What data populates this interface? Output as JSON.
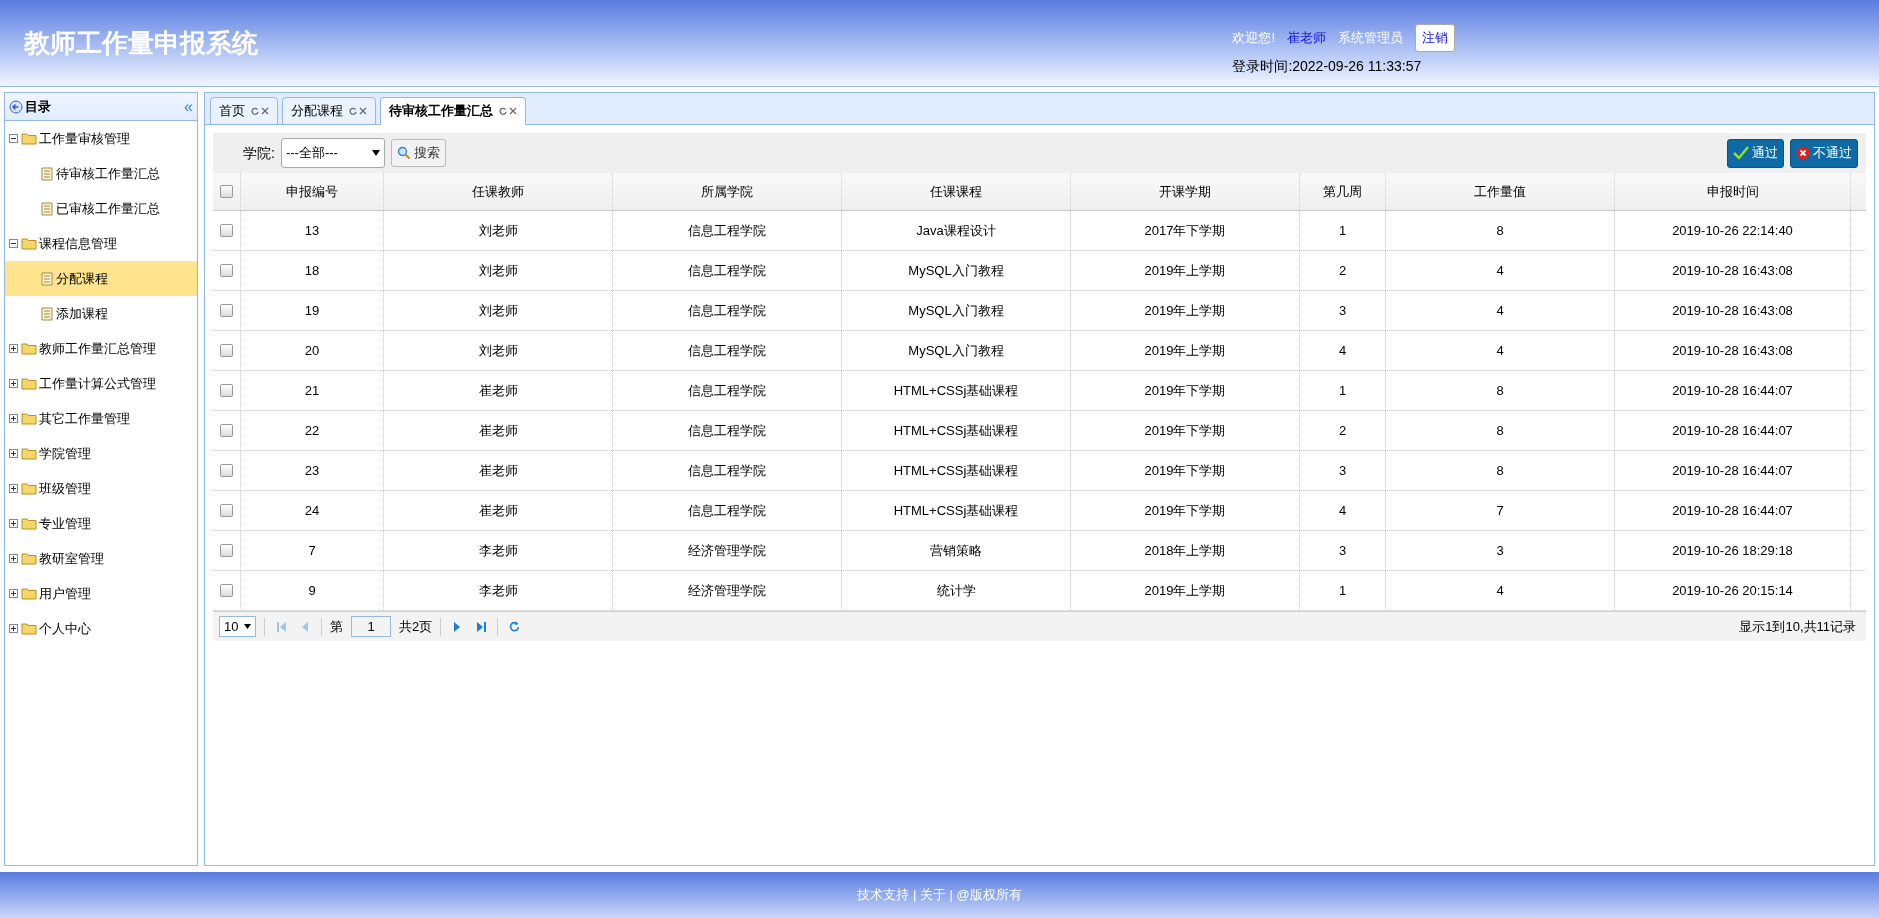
{
  "header": {
    "title": "教师工作量申报系统",
    "welcome": "欢迎您!",
    "user": "崔老师",
    "role": "系统管理员",
    "logout": "注销",
    "login_time": "登录时间:2022-09-26 11:33:57"
  },
  "sidebar": {
    "title": "目录",
    "collapse": "«",
    "items": [
      {
        "label": "工作量审核管理",
        "expanded": true,
        "selected": false,
        "children": [
          {
            "label": "待审核工作量汇总",
            "selected": false
          },
          {
            "label": "已审核工作量汇总",
            "selected": false
          }
        ]
      },
      {
        "label": "课程信息管理",
        "expanded": true,
        "selected": false,
        "children": [
          {
            "label": "分配课程",
            "selected": true
          },
          {
            "label": "添加课程",
            "selected": false
          }
        ]
      },
      {
        "label": "教师工作量汇总管理",
        "expanded": false,
        "selected": false
      },
      {
        "label": "工作量计算公式管理",
        "expanded": false,
        "selected": false
      },
      {
        "label": "其它工作量管理",
        "expanded": false,
        "selected": false
      },
      {
        "label": "学院管理",
        "expanded": false,
        "selected": false
      },
      {
        "label": "班级管理",
        "expanded": false,
        "selected": false
      },
      {
        "label": "专业管理",
        "expanded": false,
        "selected": false
      },
      {
        "label": "教研室管理",
        "expanded": false,
        "selected": false
      },
      {
        "label": "用户管理",
        "expanded": false,
        "selected": false
      },
      {
        "label": "个人中心",
        "expanded": false,
        "selected": false
      }
    ]
  },
  "tabs": [
    {
      "label": "首页",
      "selected": false
    },
    {
      "label": "分配课程",
      "selected": false
    },
    {
      "label": "待审核工作量汇总",
      "selected": true
    }
  ],
  "toolbar": {
    "college_label": "学院:",
    "college_value": "---全部---",
    "search": "搜索",
    "approve": "通过",
    "reject": "不通过"
  },
  "table": {
    "header_checked": false,
    "columns": [
      "申报编号",
      "任课教师",
      "所属学院",
      "任课课程",
      "开课学期",
      "第几周",
      "工作量值",
      "申报时间"
    ],
    "rows": [
      {
        "checked": false,
        "cells": [
          "13",
          "刘老师",
          "信息工程学院",
          "Java课程设计",
          "2017年下学期",
          "1",
          "8",
          "2019-10-26 22:14:40"
        ]
      },
      {
        "checked": false,
        "cells": [
          "18",
          "刘老师",
          "信息工程学院",
          "MySQL入门教程",
          "2019年上学期",
          "2",
          "4",
          "2019-10-28 16:43:08"
        ]
      },
      {
        "checked": false,
        "cells": [
          "19",
          "刘老师",
          "信息工程学院",
          "MySQL入门教程",
          "2019年上学期",
          "3",
          "4",
          "2019-10-28 16:43:08"
        ]
      },
      {
        "checked": false,
        "cells": [
          "20",
          "刘老师",
          "信息工程学院",
          "MySQL入门教程",
          "2019年上学期",
          "4",
          "4",
          "2019-10-28 16:43:08"
        ]
      },
      {
        "checked": false,
        "cells": [
          "21",
          "崔老师",
          "信息工程学院",
          "HTML+CSSj基础课程",
          "2019年下学期",
          "1",
          "8",
          "2019-10-28 16:44:07"
        ]
      },
      {
        "checked": false,
        "cells": [
          "22",
          "崔老师",
          "信息工程学院",
          "HTML+CSSj基础课程",
          "2019年下学期",
          "2",
          "8",
          "2019-10-28 16:44:07"
        ]
      },
      {
        "checked": false,
        "cells": [
          "23",
          "崔老师",
          "信息工程学院",
          "HTML+CSSj基础课程",
          "2019年下学期",
          "3",
          "8",
          "2019-10-28 16:44:07"
        ]
      },
      {
        "checked": false,
        "cells": [
          "24",
          "崔老师",
          "信息工程学院",
          "HTML+CSSj基础课程",
          "2019年下学期",
          "4",
          "7",
          "2019-10-28 16:44:07"
        ]
      },
      {
        "checked": false,
        "cells": [
          "7",
          "李老师",
          "经济管理学院",
          "营销策略",
          "2018年上学期",
          "3",
          "3",
          "2019-10-26 18:29:18"
        ]
      },
      {
        "checked": false,
        "cells": [
          "9",
          "李老师",
          "经济管理学院",
          "统计学",
          "2019年上学期",
          "1",
          "4",
          "2019-10-26 20:15:14"
        ]
      }
    ]
  },
  "pagination": {
    "page_size": "10",
    "page_prefix": "第",
    "page": "1",
    "page_suffix": "共2页",
    "summary": "显示1到10,共11记录"
  },
  "footer": "技术支持 | 关于 | @版权所有"
}
